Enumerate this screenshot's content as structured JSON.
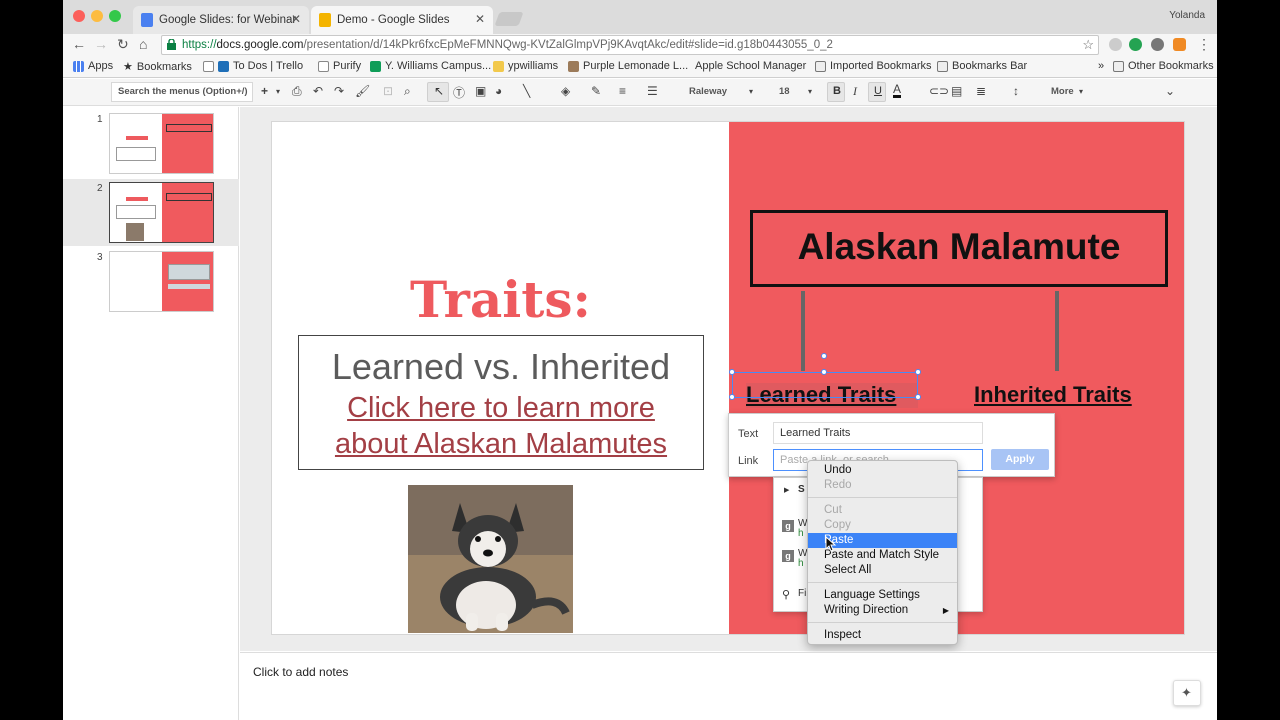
{
  "browser": {
    "profile_name": "Yolanda",
    "tabs": [
      {
        "title": "Google Slides: for Webinar - G",
        "active": false
      },
      {
        "title": "Demo - Google Slides",
        "active": true
      }
    ],
    "url_scheme": "https://",
    "url_host": "docs.google.com",
    "url_path": "/presentation/d/14kPkr6fxcEpMeFMNNQwg-KVtZalGlmpVPj9KAvqtAkc/edit#slide=id.g18b0443055_0_2",
    "bookmarks": [
      "Apps",
      "Bookmarks",
      "To Dos | Trello",
      "Purify",
      "Y. Williams Campus...",
      "ypwilliams",
      "Purple Lemonade L...",
      "Apple School Manager",
      "Imported Bookmarks",
      "Bookmarks Bar"
    ],
    "bookmarks_overflow": "»",
    "other_bookmarks": "Other Bookmarks"
  },
  "toolbar": {
    "search_placeholder": "Search the menus (Option+/)",
    "font": "Raleway",
    "font_size": "18",
    "more": "More"
  },
  "filmstrip": {
    "slides": [
      {
        "num": "1"
      },
      {
        "num": "2"
      },
      {
        "num": "3"
      }
    ]
  },
  "slide": {
    "title": "Traits:",
    "subtitle": "Learned vs. Inherited",
    "link_line1": "Click here to learn more",
    "link_line2": "about Alaskan Malamutes",
    "right_title": "Alaskan Malamute",
    "learned_label": "Learned Traits",
    "inherited_label": "Inherited Traits"
  },
  "link_popup": {
    "text_label": "Text",
    "text_value": "Learned Traits",
    "link_label": "Link",
    "link_placeholder": "Paste a link, or search",
    "apply_label": "Apply",
    "suggest_first": "S",
    "suggest_w1": "W",
    "suggest_w2": "W",
    "suggest_h": "h",
    "suggest_find": "Fi"
  },
  "context_menu": {
    "items": [
      {
        "label": "Undo",
        "state": "enabled"
      },
      {
        "label": "Redo",
        "state": "disabled"
      },
      {
        "label": "Cut",
        "state": "disabled"
      },
      {
        "label": "Copy",
        "state": "disabled"
      },
      {
        "label": "Paste",
        "state": "highlighted"
      },
      {
        "label": "Paste and Match Style",
        "state": "enabled"
      },
      {
        "label": "Select All",
        "state": "enabled"
      },
      {
        "label": "Language Settings",
        "state": "enabled"
      },
      {
        "label": "Writing Direction",
        "state": "enabled"
      },
      {
        "label": "Inspect",
        "state": "enabled"
      }
    ]
  },
  "notes": {
    "placeholder": "Click to add notes"
  },
  "colors": {
    "slide_red": "#f05a5e",
    "title_red": "#ee5a5e",
    "link_color": "#a33f45",
    "menu_highlight": "#3b83f7"
  }
}
